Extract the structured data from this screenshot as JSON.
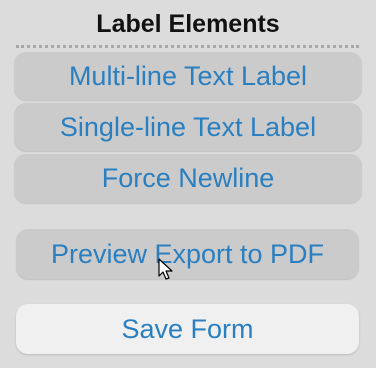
{
  "panel": {
    "title": "Label Elements"
  },
  "buttons": {
    "multi_line": "Multi-line Text Label",
    "single_line": "Single-line Text Label",
    "force_newline": "Force Newline",
    "preview_export": "Preview Export to PDF",
    "save_form": "Save Form"
  },
  "colors": {
    "background": "#dcdcdc",
    "button_bg": "#cbcbcb",
    "save_button_bg": "#f0f0f0",
    "button_text": "#2a7fc1",
    "title_text": "#111111"
  },
  "cursor": {
    "icon": "mouse-pointer-icon"
  }
}
